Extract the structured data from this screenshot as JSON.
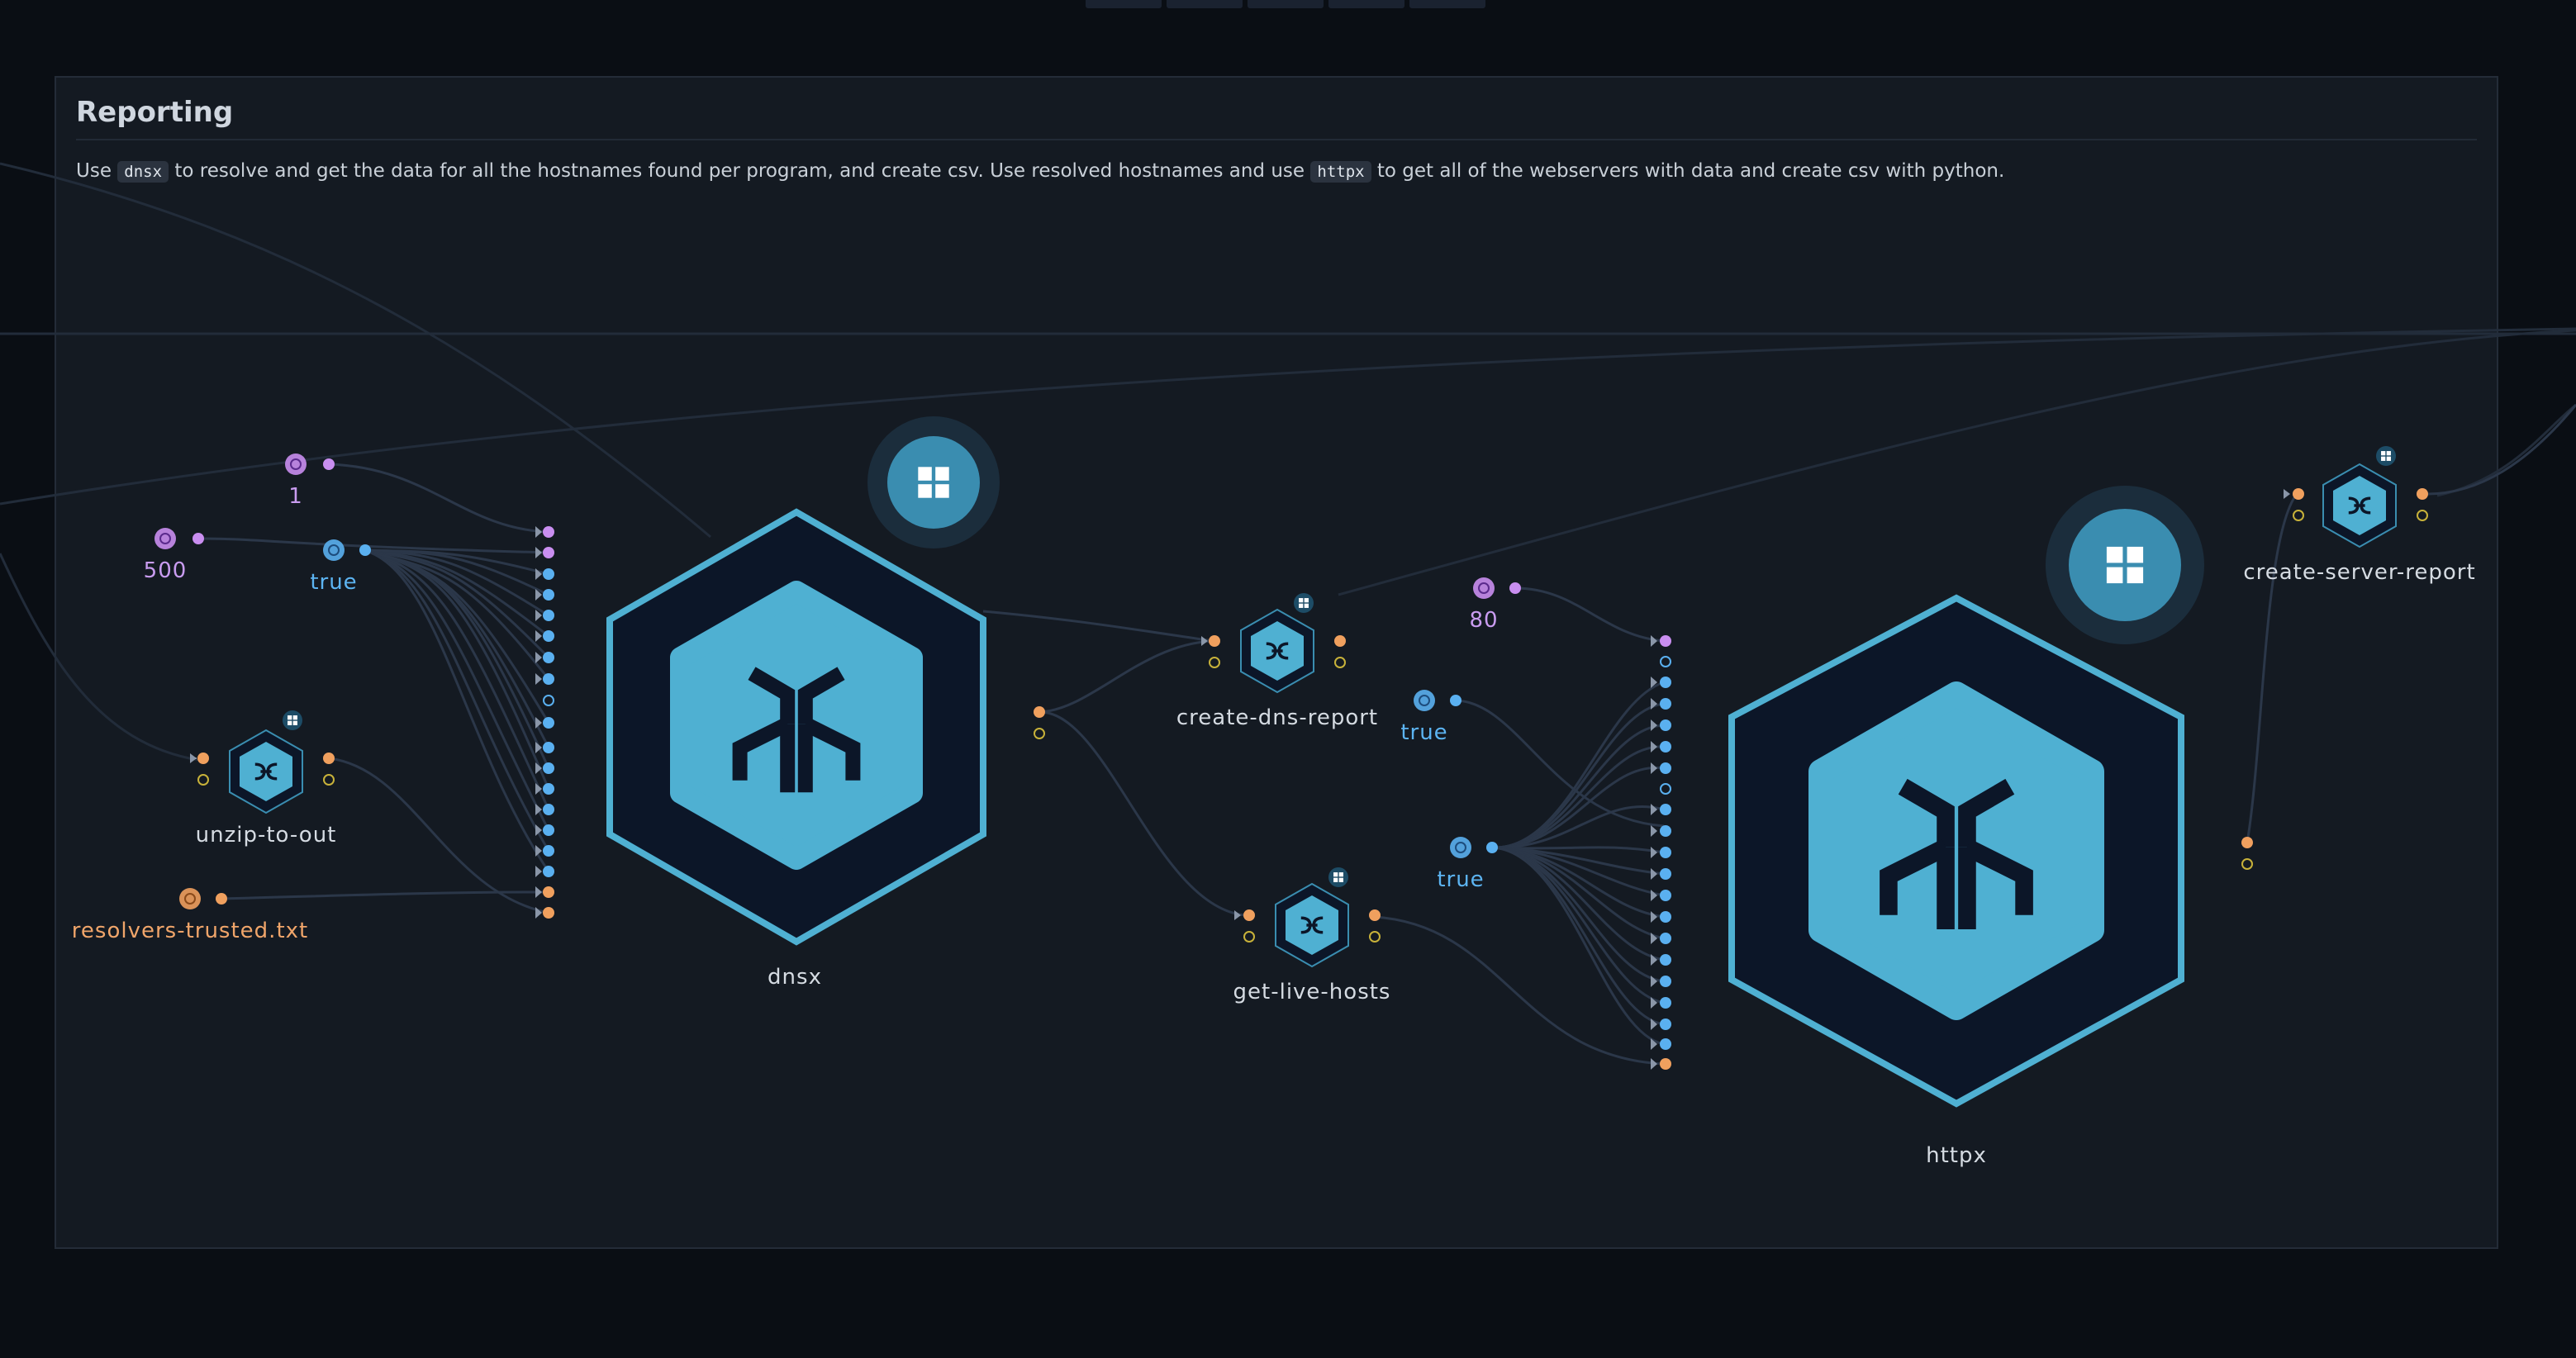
{
  "group": {
    "title": "Reporting",
    "desc_1": "Use ",
    "code_1": "dnsx",
    "desc_2": " to resolve and get the data for all the hostnames found per program, and create csv. Use resolved hostnames and use ",
    "code_2": "httpx",
    "desc_3": " to get all of the webservers with data and create csv with python."
  },
  "params": {
    "one": "1",
    "five_hundred": "500",
    "true_a": "true",
    "resolvers": "resolvers-trusted.txt",
    "eighty": "80",
    "true_b": "true",
    "true_c": "true"
  },
  "nodes": {
    "unzip": "unzip-to-out",
    "dnsx": "dnsx",
    "create_dns_report": "create-dns-report",
    "get_live_hosts": "get-live-hosts",
    "httpx": "httpx",
    "create_server_report": "create-server-report"
  },
  "colors": {
    "accent": "#4fb0d2",
    "port_orange": "#f0a05e",
    "port_blue": "#5ab0f0",
    "port_purple": "#c98ef0",
    "port_yellow": "#c8b23a",
    "node_bg": "#0c1628",
    "background": "#0a0e14",
    "group_bg": "#141a22"
  },
  "icons": {
    "module": "hex-y-logo-icon",
    "script": "python-snake-icon",
    "module_badge": "grid-four-squares-icon",
    "param": "parameter-icon"
  }
}
